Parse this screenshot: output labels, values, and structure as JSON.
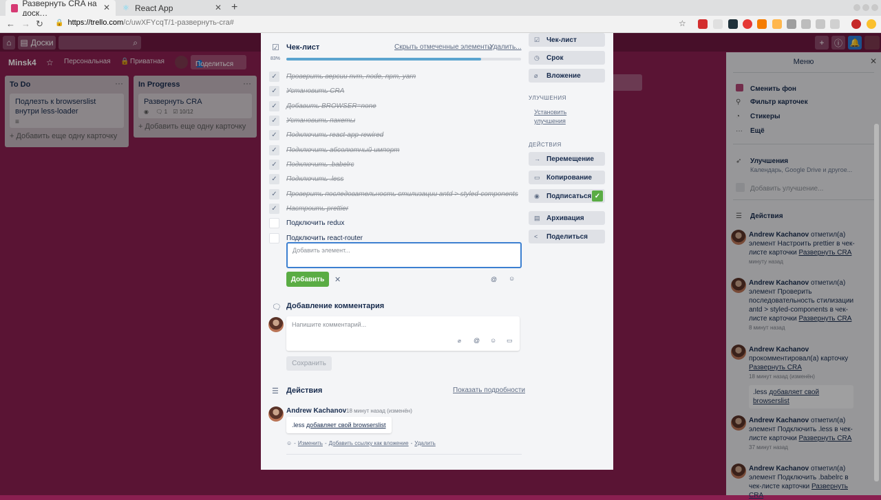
{
  "browser": {
    "tabs": [
      {
        "title": "Развернуть CRA на доск…",
        "close": "✕"
      },
      {
        "title": "React App",
        "close": "✕"
      }
    ],
    "new_tab": "+",
    "url_host": "https://trello.com",
    "url_path": "/c/uwXFYcqT/1-развернуть-cra#"
  },
  "trello_header": {
    "boards_label": "Доски",
    "plus": "+"
  },
  "board": {
    "name": "Minsk4",
    "team": "Персональная",
    "visibility": "Приватная",
    "share": "Поделиться"
  },
  "lists": [
    {
      "title": "To Do",
      "card_text": "Подлезть к browserslist внутри less-loader",
      "add_card": "+ Добавить еще одну карточку"
    },
    {
      "title": "In Progress",
      "card_text": "Развернуть CRA",
      "comments": "1",
      "checklist": "10/12",
      "add_card": "+ Добавить еще одну карточку"
    }
  ],
  "checklist": {
    "title": "Чек-лист",
    "hide_checked": "Скрыть отмеченные элементы",
    "delete": "Удалить...",
    "progress_label": "83%",
    "progress": 0.83,
    "items": [
      {
        "text": "Проверить версии nvm, node, npm, yarn",
        "done": true
      },
      {
        "text": "Установить CRA",
        "done": true
      },
      {
        "text": "Добавить BROWSER=none",
        "done": true
      },
      {
        "text": "Установить пакеты",
        "done": true
      },
      {
        "text": "Подключить react-app-rewired",
        "done": true
      },
      {
        "text": "Подключить абсолютный импорт",
        "done": true
      },
      {
        "text": "Подключить .babelrc",
        "done": true
      },
      {
        "text": "Подключить .less",
        "done": true
      },
      {
        "text": "Проверить последовательность стилизации antd > styled-components",
        "done": true
      },
      {
        "text": "Настроить prettier",
        "done": true
      },
      {
        "text": "Подключить redux",
        "done": false
      },
      {
        "text": "Подключить react-router",
        "done": false
      }
    ],
    "add_placeholder": "Добавить элемент...",
    "add_button": "Добавить"
  },
  "comment": {
    "title": "Добавление комментария",
    "placeholder": "Напишите комментарий...",
    "save": "Сохранить"
  },
  "activity": {
    "title": "Действия",
    "details": "Показать подробности",
    "author": "Andrew Kachanov",
    "time": "18 минут назад (изменён)",
    "text_prefix": ".less",
    "text_link": "добавляет свой browserslist",
    "edit": "Изменить",
    "sep": "-",
    "add_link": "Добавить ссылку как вложение",
    "remove": "Удалить"
  },
  "sidebar": {
    "checklist": "Чек-лист",
    "due": "Срок",
    "attachment": "Вложение",
    "improvements_head": "УЛУЧШЕНИЯ",
    "install_improvements": "Установить улучшения",
    "actions_head": "ДЕЙСТВИЯ",
    "move": "Перемещение",
    "copy": "Копирование",
    "subscribe": "Подписаться",
    "archive": "Архивация",
    "share": "Поделиться"
  },
  "menu": {
    "title": "Меню",
    "change_bg": "Сменить фон",
    "filter": "Фильтр карточек",
    "stickers": "Стикеры",
    "more": "Ещё",
    "improvements": "Улучшения",
    "improvements_desc": "Календарь, Google Drive и другое...",
    "add_improvement": "Добавить улучшение...",
    "actions": "Действия",
    "entries": [
      {
        "author": "Andrew Kachanov",
        "pre": " отметил(а) элемент Настроить prettier в чек-листе карточки ",
        "link": "Развернуть CRA",
        "time": "минуту назад"
      },
      {
        "author": "Andrew Kachanov",
        "pre": " отметил(а) элемент Проверить последовательность стилизации antd > styled-components в чек-листе карточки ",
        "link": "Развернуть CRA",
        "time": "8 минут назад"
      },
      {
        "author": "Andrew Kachanov",
        "pre": " прокомментировал(а) карточку ",
        "link": "Развернуть CRA",
        "time": "18 минут назад (изменён)",
        "quote_prefix": ".less",
        "quote_link": "добавляет свой browserslist"
      },
      {
        "author": "Andrew Kachanov",
        "pre": " отметил(а) элемент Подключить .less в чек-листе карточки ",
        "link": "Развернуть CRA",
        "time": "37 минут назад"
      },
      {
        "author": "Andrew Kachanov",
        "pre": " отметил(а) элемент Подключить .babelrc в чек-листе карточки ",
        "link": "Развернуть CRA",
        "time": ""
      }
    ]
  }
}
